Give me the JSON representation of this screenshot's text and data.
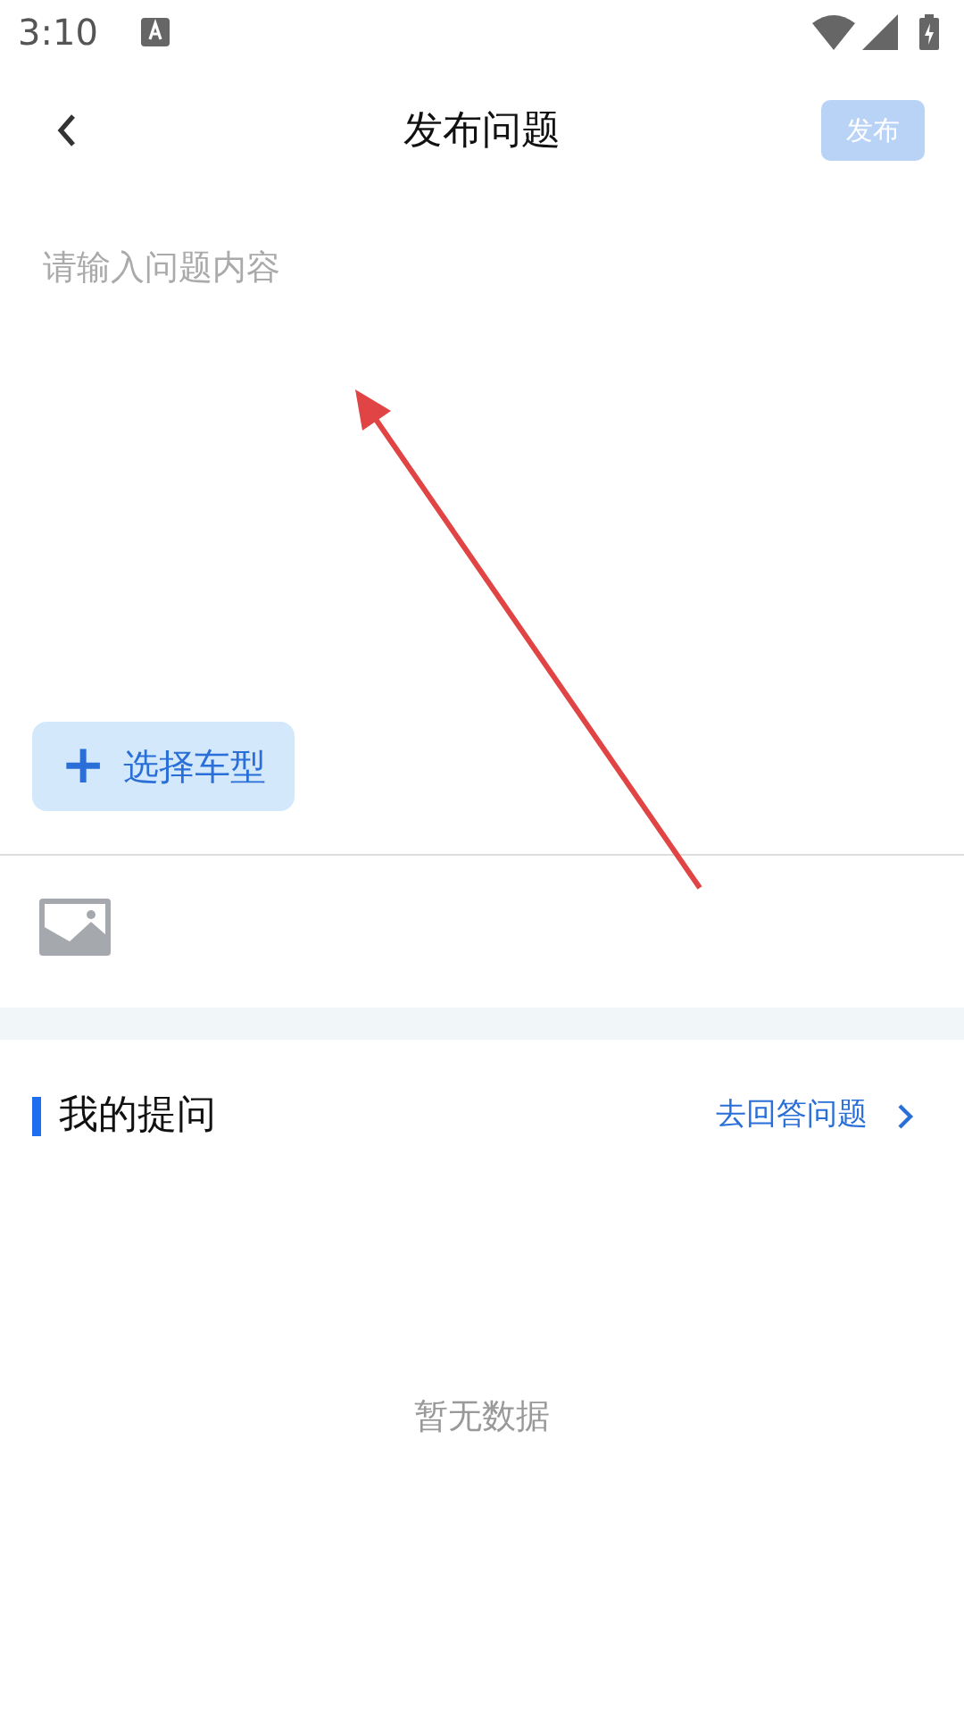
{
  "status_bar": {
    "time": "3:10"
  },
  "header": {
    "title": "发布问题",
    "publish_button": {
      "label": "发布",
      "disabled": true
    }
  },
  "question_field": {
    "placeholder": "请输入问题内容"
  },
  "car_model_button": {
    "icon": "+",
    "label": "选择车型"
  },
  "my_questions": {
    "title": "我的提问",
    "link": "去回答问题",
    "empty_text": "暂无数据"
  }
}
